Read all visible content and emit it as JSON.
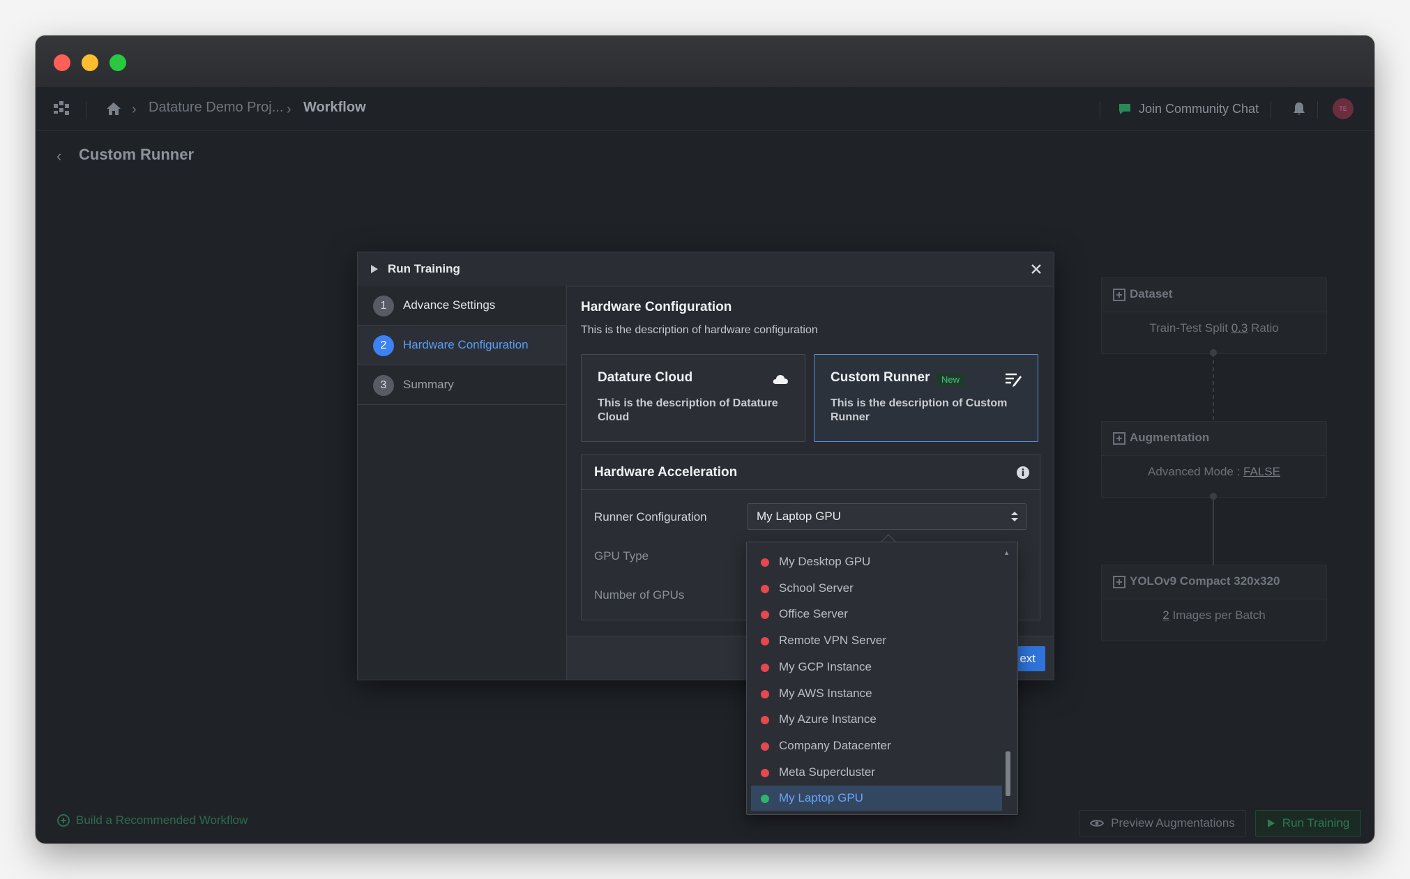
{
  "breadcrumb": {
    "project": "Datature Demo Proj...",
    "current": "Workflow"
  },
  "header": {
    "community_label": "Join Community Chat",
    "avatar_initials": "TE"
  },
  "page": {
    "title": "Custom Runner"
  },
  "workflow": {
    "nodes": [
      {
        "title": "Dataset",
        "pre": "Train-Test Split ",
        "value": "0.3",
        "post": " Ratio"
      },
      {
        "title": "Augmentation",
        "pre": "Advanced Mode : ",
        "value": "FALSE",
        "post": ""
      },
      {
        "title": "YOLOv9 Compact 320x320",
        "pre": "",
        "value": "2",
        "post": " Images per Batch"
      }
    ],
    "build_recommended": "Build a Recommended Workflow",
    "preview_button": "Preview Augmentations",
    "run_button": "Run Training"
  },
  "modal": {
    "title": "Run Training",
    "steps": [
      {
        "num": "1",
        "label": "Advance Settings"
      },
      {
        "num": "2",
        "label": "Hardware Configuration"
      },
      {
        "num": "3",
        "label": "Summary"
      }
    ],
    "hardware": {
      "title": "Hardware Configuration",
      "description": "This is the description of hardware configuration",
      "cards": [
        {
          "title": "Datature Cloud",
          "description": "This is the description of Datature Cloud",
          "icon": "cloud-icon"
        },
        {
          "title": "Custom Runner",
          "badge": "New",
          "description": "This is the description of Custom Runner",
          "icon": "custom-runner-icon"
        }
      ]
    },
    "acceleration": {
      "title": "Hardware Acceleration",
      "runner_label": "Runner Configuration",
      "runner_value": "My Laptop GPU",
      "gpu_type_label": "GPU Type",
      "num_gpus_label": "Number of GPUs"
    },
    "next_label": "ext"
  },
  "dropdown": {
    "options": [
      {
        "label": "My Desktop GPU",
        "status": "offline"
      },
      {
        "label": "School Server",
        "status": "offline"
      },
      {
        "label": "Office Server",
        "status": "offline"
      },
      {
        "label": "Remote VPN Server",
        "status": "offline"
      },
      {
        "label": "My GCP Instance",
        "status": "offline"
      },
      {
        "label": "My AWS Instance",
        "status": "offline"
      },
      {
        "label": "My Azure Instance",
        "status": "offline"
      },
      {
        "label": "Company Datacenter",
        "status": "offline"
      },
      {
        "label": "Meta Supercluster",
        "status": "offline"
      },
      {
        "label": "My Laptop GPU",
        "status": "online",
        "selected": true
      }
    ]
  },
  "colors": {
    "accent": "#3b82f6",
    "offline": "#e5484d",
    "online": "#2fb36d",
    "brand_green": "#2e7a53"
  }
}
